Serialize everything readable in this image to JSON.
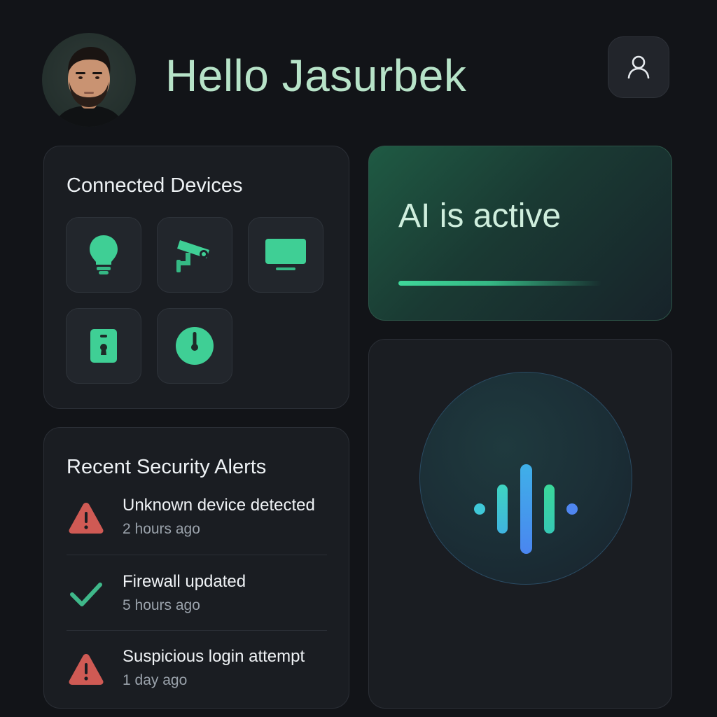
{
  "header": {
    "greeting": "Hello Jasurbek",
    "avatar_icon": "user-avatar-photo",
    "profile_icon": "user-profile-icon"
  },
  "devices": {
    "title": "Connected Devices",
    "items": [
      {
        "icon": "lightbulb-icon"
      },
      {
        "icon": "security-camera-icon"
      },
      {
        "icon": "monitor-icon"
      },
      {
        "icon": "smart-lock-icon"
      },
      {
        "icon": "thermostat-icon"
      }
    ]
  },
  "ai_status": {
    "label": "AI is active"
  },
  "alerts": {
    "title": "Recent Security Alerts",
    "items": [
      {
        "title": "Unknown device detected",
        "time": "2 hours ago",
        "status": "warning"
      },
      {
        "title": "Firewall updated",
        "time": "5 hours ago",
        "status": "success"
      },
      {
        "title": "Suspicious login attempt",
        "time": "1 day ago",
        "status": "warning"
      }
    ]
  },
  "colors": {
    "background": "#121418",
    "accent_green": "#3fd89a",
    "accent_blue": "#4f86f0",
    "warning_red": "#d05a55"
  }
}
